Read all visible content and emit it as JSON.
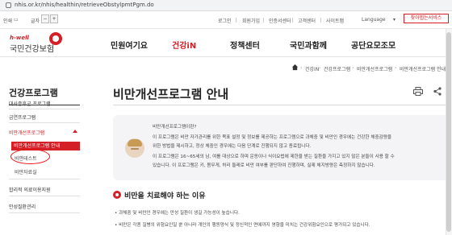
{
  "browser": {
    "url": "nhis.or.kr/nhis/healthin/retrieveObstylpmtPgm.do"
  },
  "utility": {
    "print_label": "인쇄",
    "font_label": "글자",
    "minus": "−",
    "plus": "+",
    "links": [
      "로그인",
      "회원가입",
      "인증서센터",
      "고객센터",
      "사이트맵"
    ],
    "language": "Language",
    "request_button": "찾아뵙는서비스"
  },
  "logo": {
    "sub": "h-well",
    "main": "국민건강보험"
  },
  "gnb": [
    "민원여기요",
    "건강iN",
    "정책센터",
    "국민과함께",
    "공단요모조모"
  ],
  "breadcrumb": [
    "건강iN",
    "건강프로그램",
    "비만개선프로그램",
    "비만개선프로그램 안내"
  ],
  "sidebar": {
    "title": "건강프로그램",
    "items": [
      "대사증후군 프로그램",
      "금연프로그램",
      "비만개선프로그램",
      "합리적 의료이용지원",
      "만성질환관리"
    ],
    "sub_active": "비만개선프로그램 안내",
    "sub_items": [
      "비만테스트",
      "비만자료실"
    ]
  },
  "page": {
    "title": "비만개선프로그램 안내",
    "intro_lines": [
      "비만개선프로그램이란?",
      "이 프로그램은 비만 자가관리를 위한 목표 설정 및 정보를 제공하는 프로그램으로 과체중 및 비만인 경우에는 건강한 체중감량을",
      "위한 방법을 제시하고, 정상 체중인 경우에는 다음 단계로 진행되지 않고 종료됩니다.",
      "이 프로그램은 16~65세의 남, 여를 대상으로 하며 운동이나 식이요법에 제한을 받는 질환을 가지고 있지 않은 분들이 사용 할 수",
      "있습니다. 이 프로그램은 키, 몸무게, 허리 둘레로 비만 여부를 판단하여 진행하며, 실제 체지방량은 측정하지 않습니다."
    ],
    "section_title": "비만을 치료해야 하는 이유",
    "body_lines": [
      "• 과체중 및 비만인 경우에는 만성 질환이 생길 가능성이 높습니다.",
      "• 비만은 각종 질병의 위험요인일 뿐 아니라 개인의 행동양식 및 정신적인 면에까지 영향을 미치는 건강위험요인으로 평가되고 있습니다."
    ]
  },
  "colors": {
    "accent": "#d41f26",
    "annotation": "#ee1111"
  }
}
